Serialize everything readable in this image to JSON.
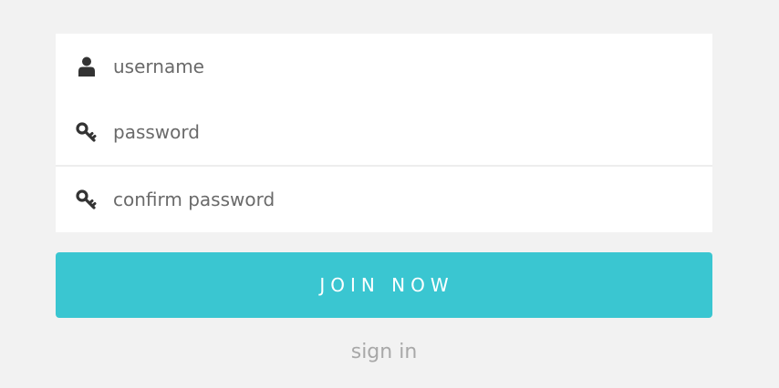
{
  "form": {
    "username": {
      "placeholder": "username",
      "value": "",
      "icon": "user-icon"
    },
    "password": {
      "placeholder": "password",
      "value": "",
      "icon": "key-icon"
    },
    "confirm_password": {
      "placeholder": "confirm password",
      "value": "",
      "icon": "key-icon"
    }
  },
  "join_button": {
    "label": "JOIN NOW"
  },
  "signin_link": {
    "label": "sign in"
  },
  "colors": {
    "background": "#f2f2f2",
    "panel": "#ffffff",
    "accent": "#3ac6d1",
    "icon": "#333333",
    "muted_text": "#a8a8a8"
  }
}
